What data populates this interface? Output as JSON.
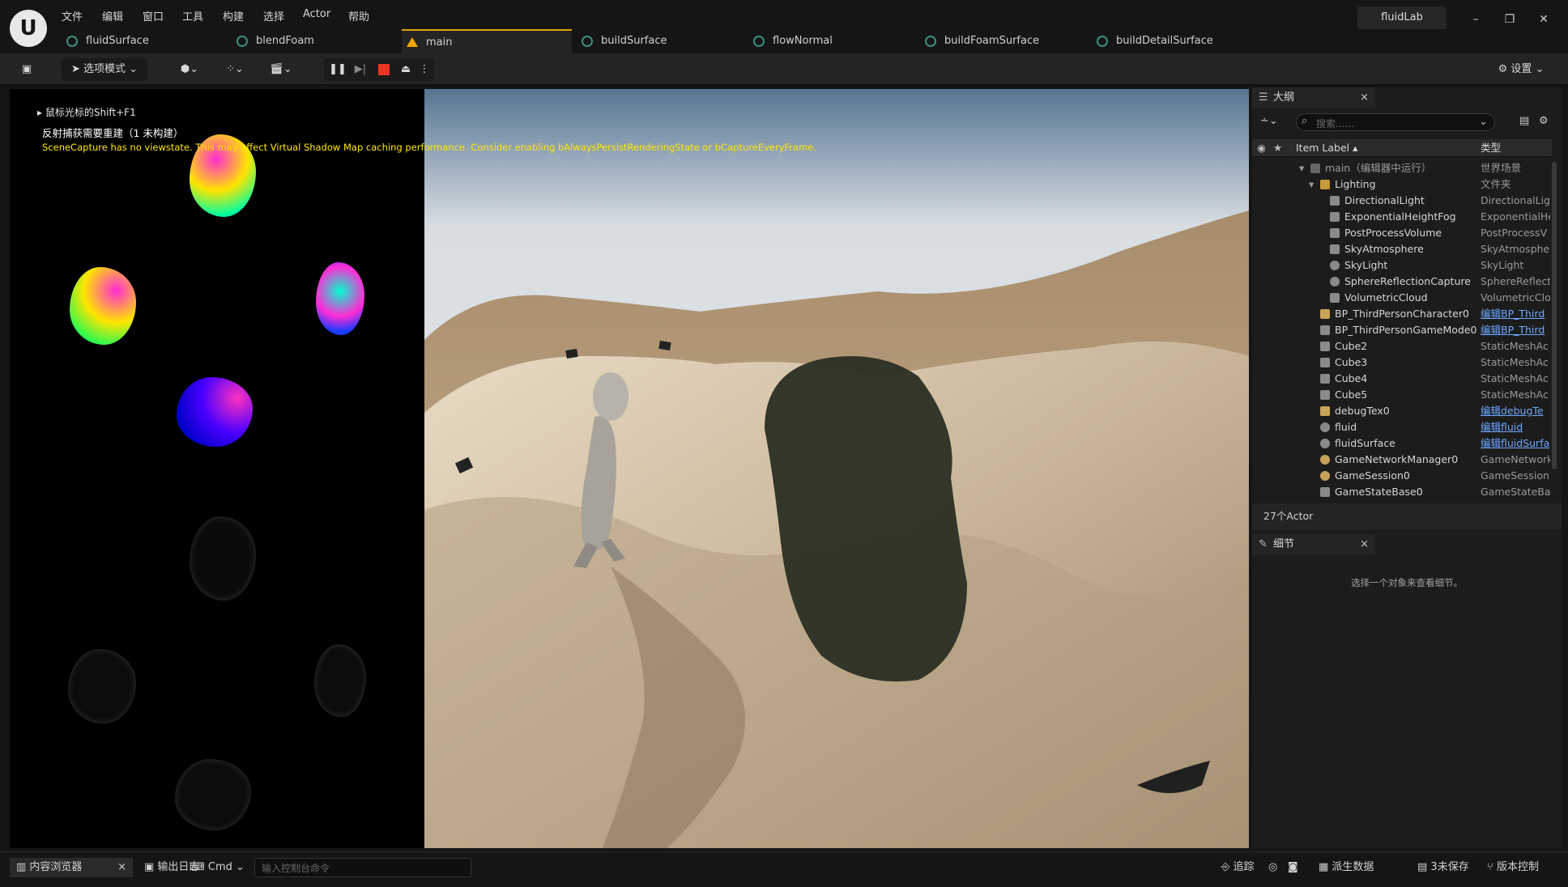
{
  "menu": [
    "文件",
    "编辑",
    "窗口",
    "工具",
    "构建",
    "选择",
    "Actor",
    "帮助"
  ],
  "project_name": "fluidLab",
  "tabs": [
    {
      "label": "fluidSurface"
    },
    {
      "label": "blendFoam"
    },
    {
      "label": "main"
    },
    {
      "label": "buildSurface"
    },
    {
      "label": "flowNormal"
    },
    {
      "label": "buildFoamSurface"
    },
    {
      "label": "buildDetailSurface"
    }
  ],
  "toolbar": {
    "mode_label": "选项模式",
    "settings_label": "设置"
  },
  "viewport_messages": {
    "hint": "鼠标光标的Shift+F1",
    "reflection": "反射捕获需要重建（1 未构建）",
    "warning": "SceneCapture has no viewstate. This may affect Virtual Shadow Map caching performance. Consider enabling bAlwaysPersistRenderingState or bCaptureEveryFrame."
  },
  "outliner": {
    "title": "大纲",
    "search_placeholder": "搜索......",
    "col_label": "Item Label",
    "col_type": "类型",
    "rows": [
      {
        "label": "main（编辑器中运行）",
        "type": "世界场景",
        "link": false
      },
      {
        "label": "Lighting",
        "type": "文件夹",
        "link": false
      },
      {
        "label": "DirectionalLight",
        "type": "DirectionalLig",
        "link": false
      },
      {
        "label": "ExponentialHeightFog",
        "type": "ExponentialHe",
        "link": false
      },
      {
        "label": "PostProcessVolume",
        "type": "PostProcessV",
        "link": false
      },
      {
        "label": "SkyAtmosphere",
        "type": "SkyAtmosphe",
        "link": false
      },
      {
        "label": "SkyLight",
        "type": "SkyLight",
        "link": false
      },
      {
        "label": "SphereReflectionCapture",
        "type": "SphereReflect",
        "link": false
      },
      {
        "label": "VolumetricCloud",
        "type": "VolumetricClo",
        "link": false
      },
      {
        "label": "BP_ThirdPersonCharacter0",
        "type": "编辑BP_Third",
        "link": true
      },
      {
        "label": "BP_ThirdPersonGameMode0",
        "type": "编辑BP_Third",
        "link": true
      },
      {
        "label": "Cube2",
        "type": "StaticMeshAc",
        "link": false
      },
      {
        "label": "Cube3",
        "type": "StaticMeshAc",
        "link": false
      },
      {
        "label": "Cube4",
        "type": "StaticMeshAc",
        "link": false
      },
      {
        "label": "Cube5",
        "type": "StaticMeshAc",
        "link": false
      },
      {
        "label": "debugTex0",
        "type": "编辑debugTe",
        "link": true
      },
      {
        "label": "fluid",
        "type": "编辑fluid",
        "link": true
      },
      {
        "label": "fluidSurface",
        "type": "编辑fluidSurfa",
        "link": true
      },
      {
        "label": "GameNetworkManager0",
        "type": "GameNetwork",
        "link": false
      },
      {
        "label": "GameSession0",
        "type": "GameSession",
        "link": false
      },
      {
        "label": "GameStateBase0",
        "type": "GameStateBa",
        "link": false
      }
    ],
    "count_label": "27个Actor"
  },
  "details": {
    "title": "细节",
    "empty_message": "选择一个对象来查看细节。"
  },
  "statusbar": {
    "content_browser": "内容浏览器",
    "output_log": "输出日志",
    "cmd": "Cmd",
    "console_placeholder": "输入控制台命令",
    "trace": "追踪",
    "derived_data": "派生数据",
    "unsaved": "3未保存",
    "source_control": "版本控制"
  }
}
